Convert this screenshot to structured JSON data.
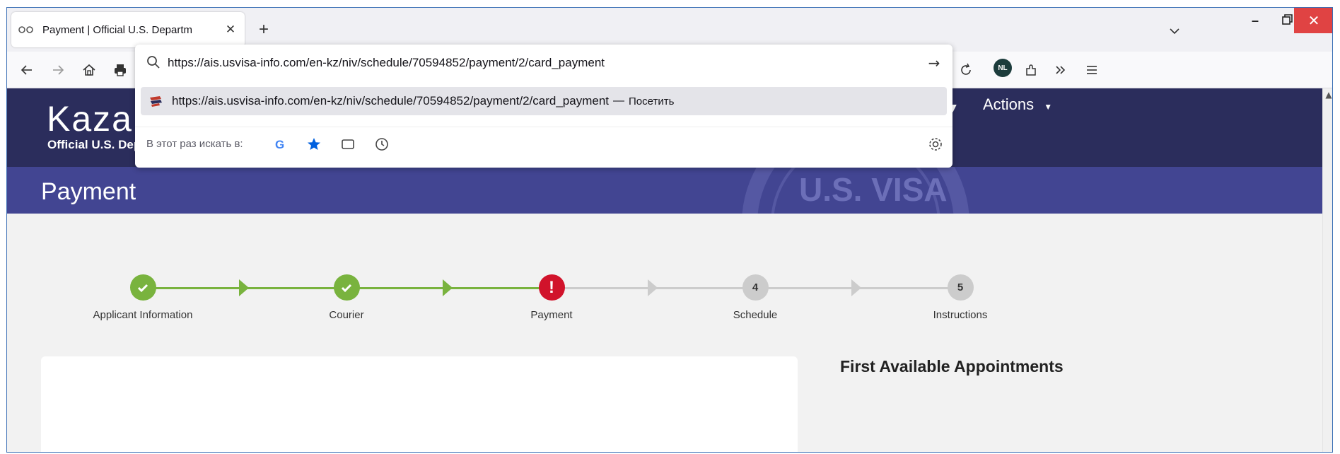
{
  "browser": {
    "tab": {
      "title": "Payment | Official U.S. Departm",
      "close_label": "✕",
      "new_tab_label": "+"
    },
    "window": {
      "minimize_label": "–",
      "close_label": "✕"
    },
    "navbar": {
      "back_icon": "back-arrow",
      "forward_icon": "forward-arrow",
      "home_icon": "home",
      "print_icon": "printer",
      "reload_icon": "reload",
      "extension_nl_label": "NL",
      "extensions_icon": "puzzle",
      "overflow_icon": "chevrons-right",
      "menu_icon": "hamburger"
    },
    "urlbar": {
      "value": "https://ais.usvisa-info.com/en-kz/niv/schedule/70594852/payment/2/card_payment",
      "suggestion": {
        "url": "https://ais.usvisa-info.com/en-kz/niv/schedule/70594852/payment/2/card_payment",
        "separator": "—",
        "action": "Посетить"
      },
      "oneoff_label": "В этот раз искать в:",
      "oneoff_engines": [
        "google",
        "bookmarks",
        "tabs",
        "history"
      ]
    }
  },
  "site": {
    "title": "Kazak",
    "subtitle": "Official U.S. Dep",
    "actions_label": "Actions",
    "page_heading": "Payment",
    "seal_text": "U.S. VISA",
    "steps": [
      {
        "label": "Applicant Information",
        "state": "done",
        "badge": ""
      },
      {
        "label": "Courier",
        "state": "done",
        "badge": ""
      },
      {
        "label": "Payment",
        "state": "error",
        "badge": "!"
      },
      {
        "label": "Schedule",
        "state": "todo",
        "badge": "4"
      },
      {
        "label": "Instructions",
        "state": "todo",
        "badge": "5"
      }
    ],
    "sidebar_heading": "First Available Appointments"
  },
  "colors": {
    "header_bg": "#2b2d5c",
    "banner_bg": "#424592",
    "step_done": "#79b33e",
    "step_error": "#d1132b",
    "step_todo": "#cccccc"
  }
}
